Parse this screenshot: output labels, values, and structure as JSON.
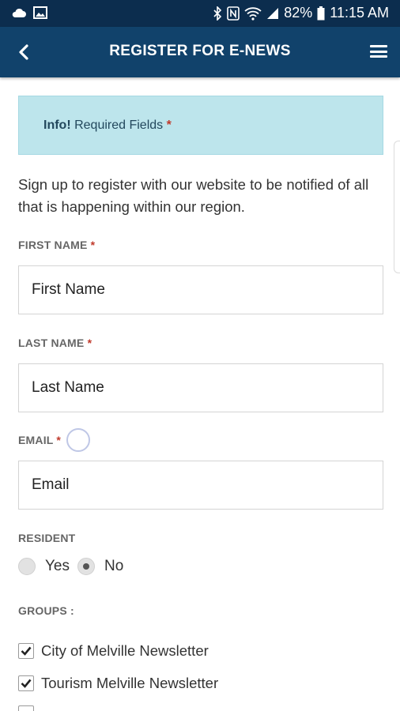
{
  "status_bar": {
    "battery": "82%",
    "time": "11:15 AM"
  },
  "header": {
    "title": "REGISTER FOR E-NEWS"
  },
  "info": {
    "bold": "Info!",
    "text": " Required Fields ",
    "required_marker": "*"
  },
  "intro_text": "Sign up to register with our website to be notified of all that is happening within our region.",
  "form": {
    "first_name": {
      "label": "FIRST NAME",
      "required": "*",
      "placeholder": "First Name"
    },
    "last_name": {
      "label": "LAST NAME",
      "required": "*",
      "placeholder": "Last Name"
    },
    "email": {
      "label": "EMAIL",
      "required": "*",
      "placeholder": "Email"
    },
    "resident": {
      "label": "RESIDENT",
      "options": [
        "Yes",
        "No"
      ],
      "selected": "No"
    },
    "groups": {
      "label": "GROUPS :",
      "items": [
        {
          "label": "City of Melville Newsletter",
          "checked": true
        },
        {
          "label": "Tourism Melville Newsletter",
          "checked": true
        }
      ]
    }
  }
}
